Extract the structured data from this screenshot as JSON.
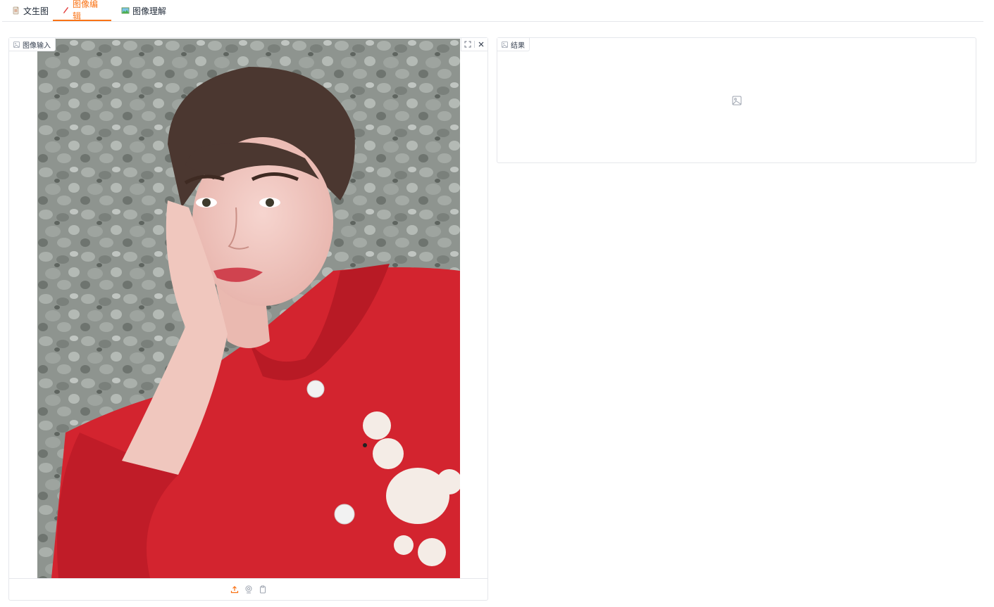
{
  "tabs": [
    {
      "label": "文生图",
      "icon": "document-icon",
      "active": false
    },
    {
      "label": "图像编辑",
      "icon": "pencil-icon",
      "active": true
    },
    {
      "label": "图像理解",
      "icon": "picture-icon",
      "active": false
    }
  ],
  "input_panel": {
    "label": "图像输入",
    "toolbar": [
      "fullscreen-icon",
      "close-icon"
    ],
    "bottom_actions": [
      "upload-icon",
      "webcam-icon",
      "clipboard-icon"
    ]
  },
  "result_panel": {
    "label": "结果",
    "empty_icon": "image-placeholder-icon"
  },
  "colors": {
    "accent": "#f97316",
    "border": "#e5e7eb",
    "coat_red": "#d3242f",
    "wall_gray": "#8f958f"
  }
}
